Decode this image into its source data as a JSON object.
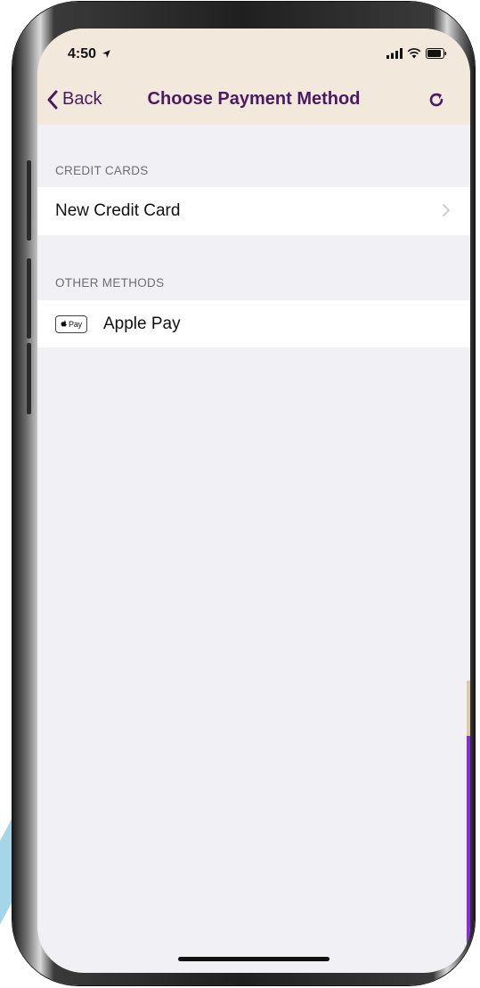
{
  "status_bar": {
    "time": "4:50",
    "location_icon": "location-arrow-icon",
    "signal_icon": "cellular-signal-icon",
    "wifi_icon": "wifi-icon",
    "battery_icon": "battery-icon"
  },
  "nav": {
    "back_label": "Back",
    "title": "Choose Payment Method",
    "refresh_icon": "refresh-icon"
  },
  "sections": [
    {
      "header": "CREDIT CARDS",
      "rows": [
        {
          "label": "New Credit Card",
          "accessory": "chevron-right-icon"
        }
      ]
    },
    {
      "header": "OTHER METHODS",
      "rows": [
        {
          "label": "Apple Pay",
          "badge": "Pay",
          "badge_icon": "apple-pay-icon"
        }
      ]
    }
  ],
  "colors": {
    "accent": "#4a1b63",
    "nav_background": "#f2e8dc",
    "screen_background": "#f1f0f5",
    "scroll_indicator": "#8a2be2"
  }
}
